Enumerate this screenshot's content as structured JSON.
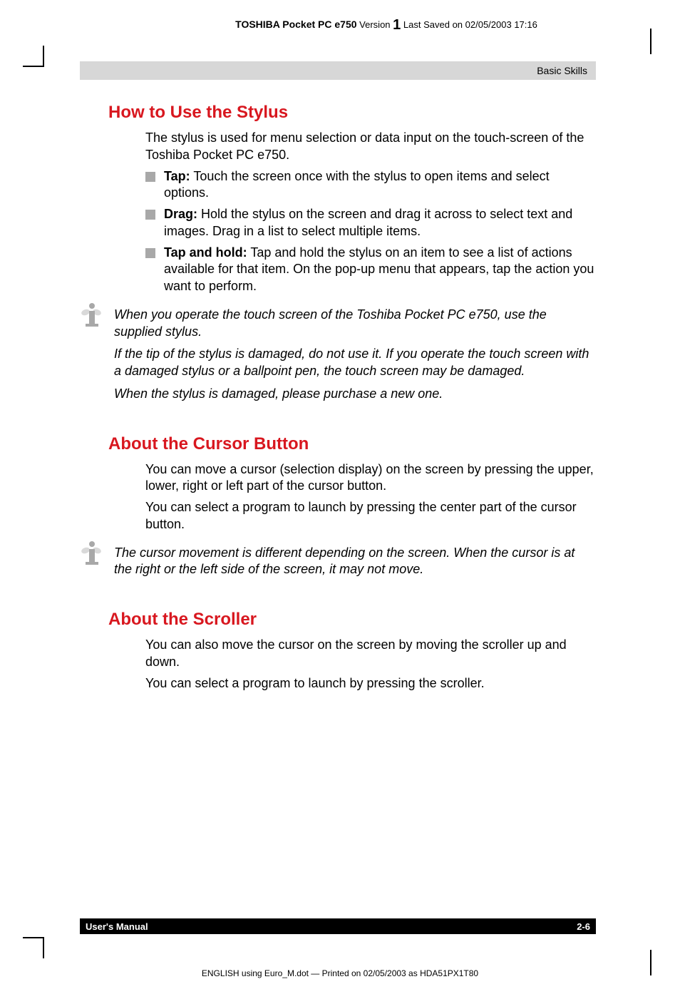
{
  "header": {
    "product": "TOSHIBA Pocket PC e750",
    "version_label": "Version",
    "version_num": "1",
    "saved": "Last Saved on 02/05/2003 17:16"
  },
  "banner": {
    "text": "Basic Skills"
  },
  "sections": {
    "stylus": {
      "title": "How to Use the Stylus",
      "intro": "The stylus is used for menu selection or data input on the touch-screen of the Toshiba Pocket PC e750.",
      "bullets": [
        {
          "label": "Tap:",
          "text": " Touch the screen once with the stylus to open items and select options."
        },
        {
          "label": "Drag:",
          "text": " Hold the stylus on the screen and drag it across to select text and images. Drag in a list to select multiple items."
        },
        {
          "label": "Tap and hold:",
          "text": " Tap and hold the stylus on an item to see a list of actions available for that item. On the pop-up menu that appears, tap the action you want to perform."
        }
      ],
      "notes": [
        "When you operate the touch screen of the Toshiba Pocket PC e750, use the supplied stylus.",
        "If the tip of the stylus is damaged, do not use it. If you operate the touch screen with a damaged stylus or a ballpoint pen, the touch screen may be damaged.",
        "When the stylus is damaged, please purchase a new one."
      ]
    },
    "cursor": {
      "title": "About the Cursor Button",
      "p1": "You can move a cursor (selection display) on the screen by pressing the upper, lower, right or left part of the cursor button.",
      "p2": "You can select a program to launch by pressing the center part of the cursor button.",
      "note": "The cursor movement is different depending on the screen. When the cursor is at the right or the left side of the screen, it may not move."
    },
    "scroller": {
      "title": "About the Scroller",
      "p1": "You can also move the cursor on the screen by moving the scroller up and down.",
      "p2": "You can select a program to launch by pressing the scroller."
    }
  },
  "footer": {
    "left": "User's Manual",
    "right": "2-6"
  },
  "footer_line": "ENGLISH using Euro_M.dot — Printed on 02/05/2003 as HDA51PX1T80"
}
